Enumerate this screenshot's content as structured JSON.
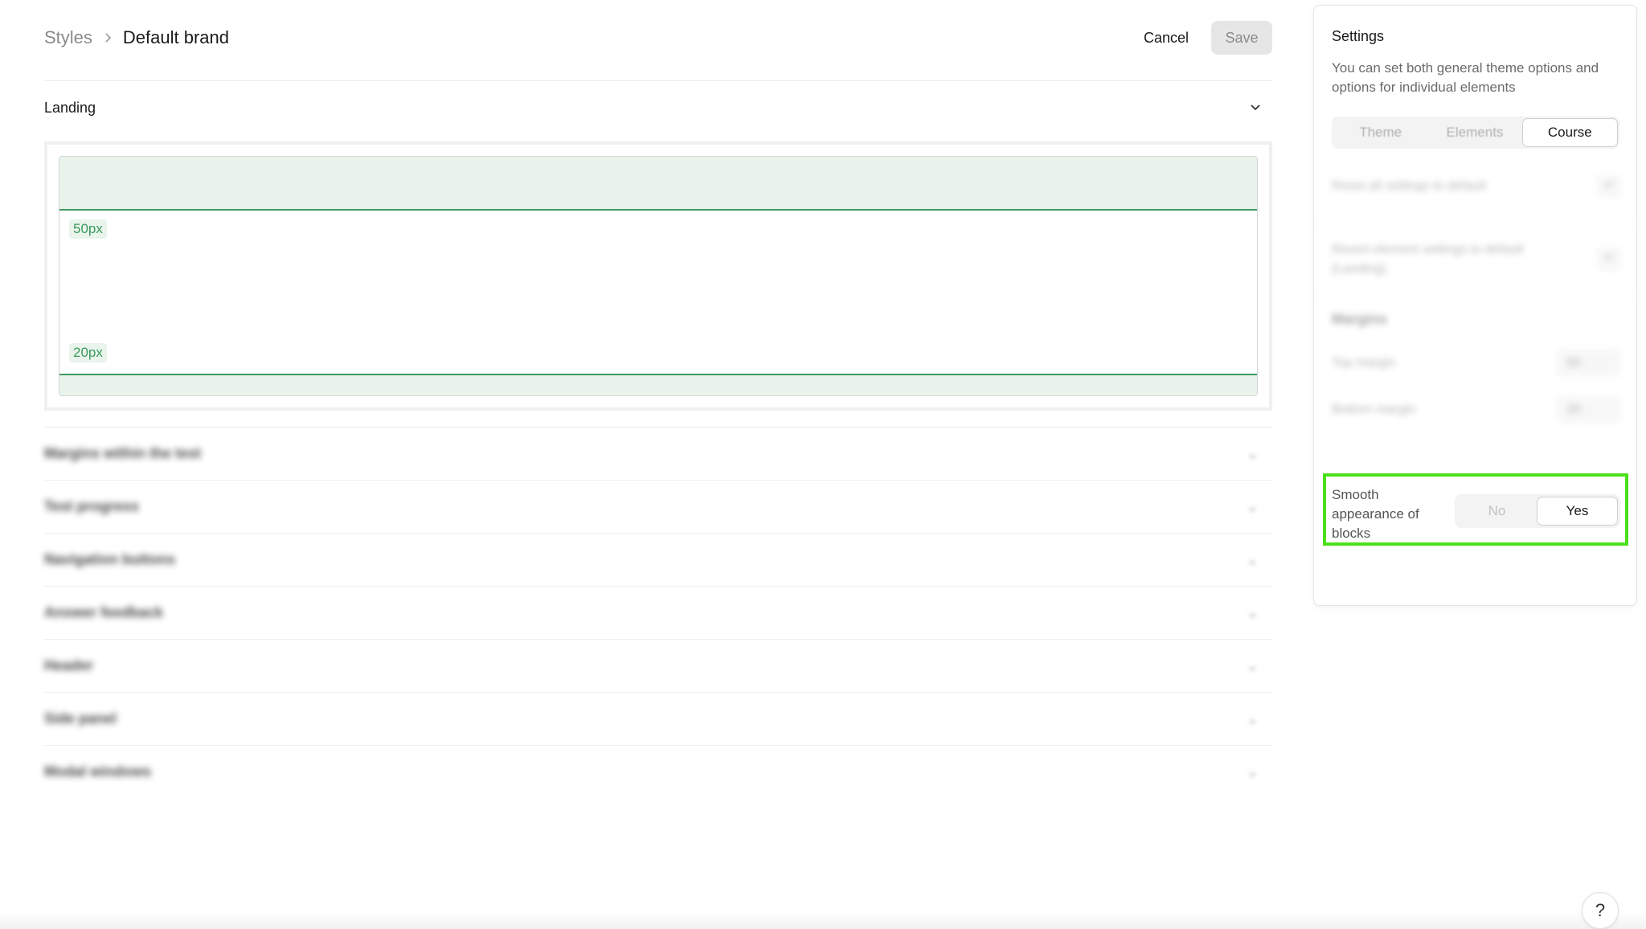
{
  "breadcrumb": {
    "root": "Styles",
    "current": "Default brand"
  },
  "actions": {
    "cancel_label": "Cancel",
    "save_label": "Save"
  },
  "landing": {
    "title": "Landing",
    "preview": {
      "top_margin_label": "50px",
      "bottom_margin_label": "20px"
    }
  },
  "sections": [
    {
      "label": "Margins within the test"
    },
    {
      "label": "Test progress"
    },
    {
      "label": "Navigation buttons"
    },
    {
      "label": "Answer feedback"
    },
    {
      "label": "Header"
    },
    {
      "label": "Side panel"
    },
    {
      "label": "Modal windows"
    }
  ],
  "settings": {
    "title": "Settings",
    "description": "You can set both general theme options and options for individual elements",
    "tabs": [
      {
        "label": "Theme",
        "active": false
      },
      {
        "label": "Elements",
        "active": false
      },
      {
        "label": "Course",
        "active": true
      }
    ],
    "reset_all_label": "Reset all settings to default",
    "revert_element_label": "Revert element settings to default (Landing)",
    "margins_heading": "Margins",
    "top_margin": {
      "label": "Top margin",
      "value": "50"
    },
    "bottom_margin": {
      "label": "Bottom margin",
      "value": "20"
    },
    "smooth_appearance": {
      "label": "Smooth appearance of blocks",
      "options": [
        "No",
        "Yes"
      ],
      "selected": "Yes"
    }
  },
  "help": {
    "label": "?"
  },
  "colors": {
    "accent_green": "#3d9a5e",
    "margin_fill": "#e9f4ec",
    "highlight": "#4be01a"
  },
  "icons": [
    "chevron-right-icon",
    "chevron-down-icon",
    "undo-icon",
    "help-icon"
  ]
}
